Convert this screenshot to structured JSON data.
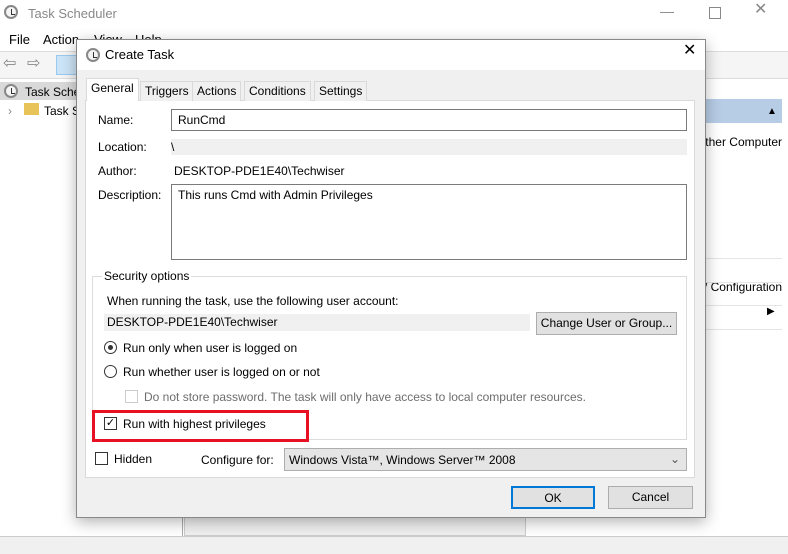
{
  "app": {
    "title": "Task Scheduler",
    "menu": [
      "File",
      "Action",
      "View",
      "Help"
    ],
    "tree": [
      "Task Scheduler (Local)",
      "Task Scheduler Library"
    ],
    "actions_pane": {
      "item1": "Connect to Another Computer...",
      "item2": "Export All Tasks / Configuration"
    }
  },
  "dialog": {
    "title": "Create Task",
    "tabs": [
      "General",
      "Triggers",
      "Actions",
      "Conditions",
      "Settings"
    ],
    "active_tab": "General",
    "name_label": "Name:",
    "name_value": "RunCmd",
    "location_label": "Location:",
    "location_value": "\\",
    "author_label": "Author:",
    "author_value": "DESKTOP-PDE1E40\\Techwiser",
    "description_label": "Description:",
    "description_value": "This runs Cmd with Admin Privileges",
    "security": {
      "legend": "Security options",
      "account_prompt": "When running the task, use the following user account:",
      "account": "DESKTOP-PDE1E40\\Techwiser",
      "change_button": "Change User or Group...",
      "radio1": "Run only when user is logged on",
      "radio2": "Run whether user is logged on or not",
      "selected_radio": 1,
      "no_store": "Do not store password.  The task will only have access to local computer resources.",
      "no_store_checked": false,
      "highest": "Run with highest privileges",
      "highest_checked": true
    },
    "hidden_label": "Hidden",
    "hidden_checked": false,
    "configure_label": "Configure for:",
    "configure_value": "Windows Vista™, Windows Server™ 2008",
    "ok": "OK",
    "cancel": "Cancel"
  },
  "colors": {
    "highlight_box": "#e81123",
    "ok_border": "#0078d7",
    "pane_header": "#b7cde6"
  }
}
